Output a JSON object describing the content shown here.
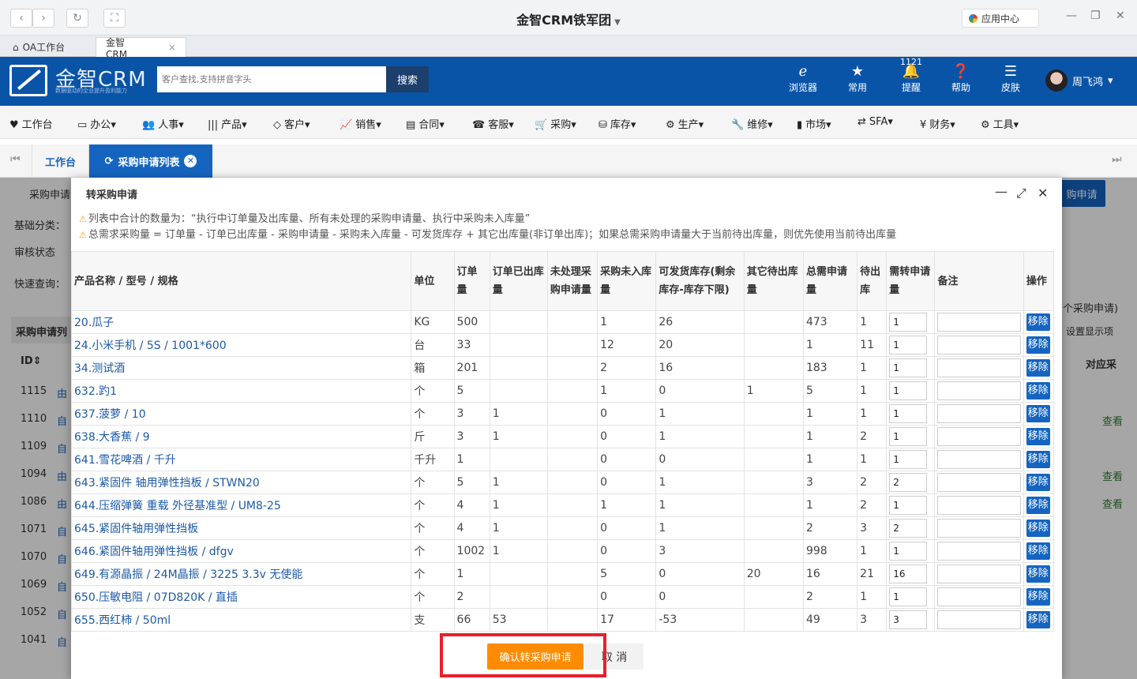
{
  "browser": {
    "window_title": "金智CRM铁军团",
    "app_center": "应用中心",
    "tabs": [
      {
        "label": "OA工作台"
      },
      {
        "label": "金智CRM"
      }
    ]
  },
  "header": {
    "logo_text": "金智CRM",
    "logo_sub": "数据驱动的企业提升盈利能力",
    "search_placeholder": "客户查找,支持拼音字头",
    "search_button": "搜索",
    "items": [
      {
        "label": "浏览器",
        "icon": "ie-icon"
      },
      {
        "label": "常用",
        "icon": "star-icon"
      },
      {
        "label": "提醒",
        "icon": "bell-icon",
        "badge": "1121"
      },
      {
        "label": "帮助",
        "icon": "help-icon"
      },
      {
        "label": "皮肤",
        "icon": "skin-icon"
      }
    ],
    "user": "周飞鸿"
  },
  "menu": [
    {
      "label": "工作台",
      "icon": "♥"
    },
    {
      "label": "办公",
      "icon": "▭"
    },
    {
      "label": "人事",
      "icon": "👥"
    },
    {
      "label": "产品",
      "icon": "|||"
    },
    {
      "label": "客户",
      "icon": "◇"
    },
    {
      "label": "销售",
      "icon": "📈"
    },
    {
      "label": "合同",
      "icon": "▤"
    },
    {
      "label": "客服",
      "icon": "☎"
    },
    {
      "label": "采购",
      "icon": "🛒"
    },
    {
      "label": "库存",
      "icon": "⛁"
    },
    {
      "label": "生产",
      "icon": "⚙"
    },
    {
      "label": "维修",
      "icon": "🔧"
    },
    {
      "label": "市场",
      "icon": "▮"
    },
    {
      "label": "SFA",
      "icon": "⇄"
    },
    {
      "label": "财务",
      "icon": "¥"
    },
    {
      "label": "工具",
      "icon": "⚙"
    }
  ],
  "page_tabs": {
    "home": "工作台",
    "active": "采购申请列表"
  },
  "background_page": {
    "breadcrumb": "采购申请",
    "category_label": "基础分类：",
    "audit_label": "审核状态",
    "quick_label": "快速查询：",
    "list_title": "采购申请列",
    "id_header": "ID",
    "right_header": "对应采",
    "right_button": "购申请",
    "right_note": "个采购申请)",
    "settings_label": "设置显示项",
    "view_label": "查看",
    "rows": [
      {
        "id": "1115",
        "txt": "由"
      },
      {
        "id": "1110",
        "txt": "自"
      },
      {
        "id": "1109",
        "txt": "自"
      },
      {
        "id": "1094",
        "txt": "由"
      },
      {
        "id": "1086",
        "txt": "由"
      },
      {
        "id": "1071",
        "txt": "自"
      },
      {
        "id": "1070",
        "txt": "自"
      },
      {
        "id": "1069",
        "txt": "自"
      },
      {
        "id": "1052",
        "txt": "自"
      },
      {
        "id": "1041",
        "txt": "自"
      }
    ]
  },
  "modal": {
    "title": "转采购申请",
    "notice1": "列表中合计的数量为：“执行中订单量及出库量、所有未处理的采购申请量、执行中采购未入库量”",
    "notice2": "总需求采购量 = 订单量 - 订单已出库量 - 采购申请量 - 采购未入库量 - 可发货库存 + 其它出库量(非订单出库)；如果总需采购申请量大于当前待出库量，则优先使用当前待出库量",
    "columns": [
      "产品名称 / 型号 / 规格",
      "单位",
      "订单量",
      "订单已出库量",
      "未处理采购申请量",
      "采购未入库量",
      "可发货库存(剩余库存-库存下限)",
      "其它待出库量",
      "总需申请量",
      "待出库",
      "需转申请量",
      "备注",
      "操作"
    ],
    "remove_label": "移除",
    "rows": [
      {
        "name": "20.瓜子",
        "unit": "KG",
        "order": "500",
        "shipped": "",
        "pending": "",
        "unin": "1",
        "avail": "26",
        "other": "",
        "total": "473",
        "out": "1",
        "req": "1"
      },
      {
        "name": "24.小米手机 / 5S / 1001*600",
        "unit": "台",
        "order": "33",
        "shipped": "",
        "pending": "",
        "unin": "12",
        "avail": "20",
        "other": "",
        "total": "1",
        "out": "11",
        "req": "1"
      },
      {
        "name": "34.测试酒",
        "unit": "箱",
        "order": "201",
        "shipped": "",
        "pending": "",
        "unin": "2",
        "avail": "16",
        "other": "",
        "total": "183",
        "out": "1",
        "req": "1"
      },
      {
        "name": "632.趵1",
        "unit": "个",
        "order": "5",
        "shipped": "",
        "pending": "",
        "unin": "1",
        "avail": "0",
        "other": "1",
        "total": "5",
        "out": "1",
        "req": "1"
      },
      {
        "name": "637.菠萝 / 10",
        "unit": "个",
        "order": "3",
        "shipped": "1",
        "pending": "",
        "unin": "0",
        "avail": "1",
        "other": "",
        "total": "1",
        "out": "1",
        "req": "1"
      },
      {
        "name": "638.大香蕉 / 9",
        "unit": "斤",
        "order": "3",
        "shipped": "1",
        "pending": "",
        "unin": "0",
        "avail": "1",
        "other": "",
        "total": "1",
        "out": "2",
        "req": "1"
      },
      {
        "name": "641.雪花啤酒 / 千升",
        "unit": "千升",
        "order": "1",
        "shipped": "",
        "pending": "",
        "unin": "0",
        "avail": "0",
        "other": "",
        "total": "1",
        "out": "1",
        "req": "1"
      },
      {
        "name": "643.紧固件 轴用弹性挡板 / STWN20",
        "unit": "个",
        "order": "5",
        "shipped": "1",
        "pending": "",
        "unin": "0",
        "avail": "1",
        "other": "",
        "total": "3",
        "out": "2",
        "req": "2"
      },
      {
        "name": "644.压缩弹簧 重载 外径基准型 / UM8-25",
        "unit": "个",
        "order": "4",
        "shipped": "1",
        "pending": "",
        "unin": "1",
        "avail": "1",
        "other": "",
        "total": "1",
        "out": "2",
        "req": "1"
      },
      {
        "name": "645.紧固件轴用弹性挡板",
        "unit": "个",
        "order": "4",
        "shipped": "1",
        "pending": "",
        "unin": "0",
        "avail": "1",
        "other": "",
        "total": "2",
        "out": "3",
        "req": "2"
      },
      {
        "name": "646.紧固件轴用弹性挡板 / dfgv",
        "unit": "个",
        "order": "1002",
        "shipped": "1",
        "pending": "",
        "unin": "0",
        "avail": "3",
        "other": "",
        "total": "998",
        "out": "1",
        "req": "1"
      },
      {
        "name": "649.有源晶振 / 24M晶振 / 3225 3.3v 无使能",
        "unit": "个",
        "order": "1",
        "shipped": "",
        "pending": "",
        "unin": "5",
        "avail": "0",
        "other": "20",
        "total": "16",
        "out": "21",
        "req": "16"
      },
      {
        "name": "650.压敏电阻 / 07D820K / 直插",
        "unit": "个",
        "order": "2",
        "shipped": "",
        "pending": "",
        "unin": "0",
        "avail": "0",
        "other": "",
        "total": "2",
        "out": "1",
        "req": "1"
      },
      {
        "name": "655.西红柿 / 50ml",
        "unit": "支",
        "order": "66",
        "shipped": "53",
        "pending": "",
        "unin": "17",
        "avail": "-53",
        "other": "",
        "total": "49",
        "out": "3",
        "req": "3"
      }
    ],
    "confirm_button": "确认转采购申请",
    "cancel_button": "取 消"
  },
  "colors": {
    "brand_blue": "#0a54a8",
    "confirm_orange": "#ff8c00",
    "highlight_red": "#e8202a"
  }
}
